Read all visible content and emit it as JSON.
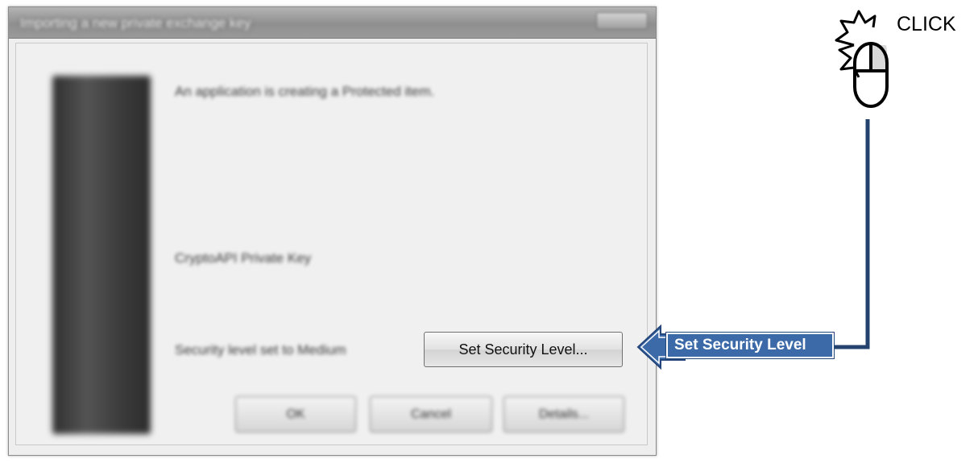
{
  "dialog": {
    "title": "Importing a new private exchange key",
    "close_label": "",
    "message": "An application is creating a Protected item.",
    "item_name": "CryptoAPI Private Key",
    "security_text": "Security level set to Medium",
    "set_security_button": "Set Security Level...",
    "ok_button": "OK",
    "cancel_button": "Cancel",
    "details_button": "Details..."
  },
  "annotation": {
    "callout_label": "Set Security Level",
    "click_label": "CLICK",
    "callout_color": "#3c6aa8",
    "connector_color": "#23436e",
    "icons": [
      "mouse-icon",
      "click-burst-icon",
      "arrow-left-icon"
    ]
  }
}
